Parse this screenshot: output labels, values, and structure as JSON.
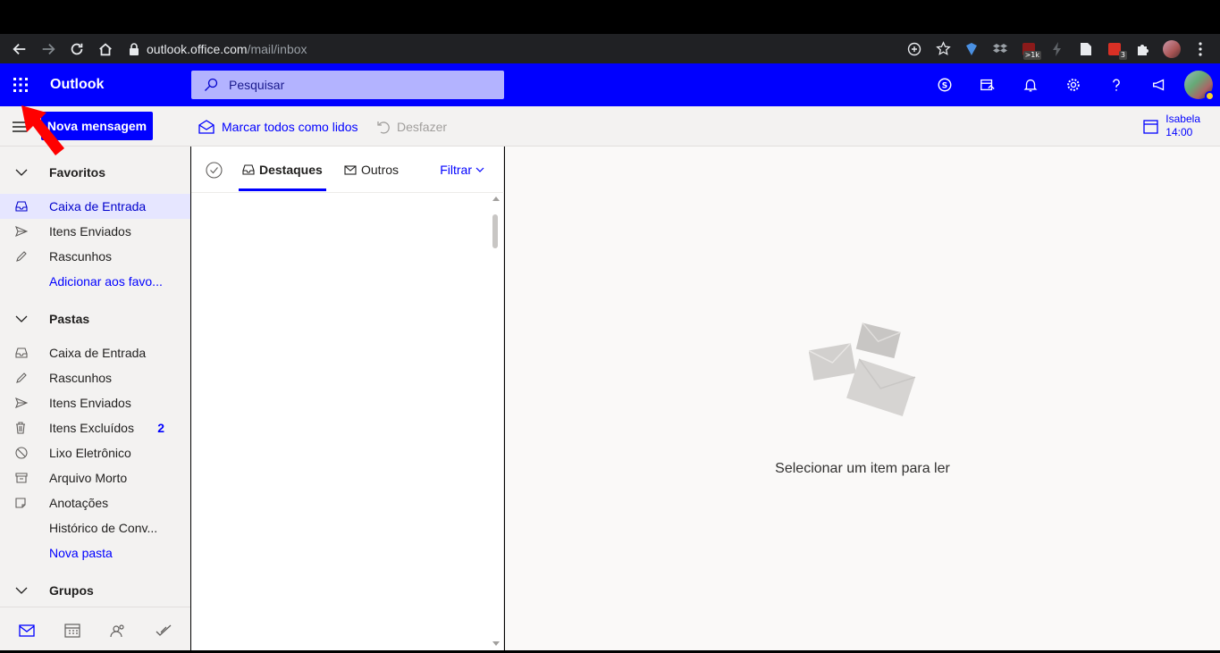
{
  "browser": {
    "url_host": "outlook.office.com",
    "url_path": "/mail/inbox",
    "extensions": [
      {
        "name": "bitwarden-icon"
      },
      {
        "name": "dropbox-icon"
      },
      {
        "name": "pdf-extension-icon",
        "badge": ">1k"
      },
      {
        "name": "flash-icon"
      },
      {
        "name": "document-icon"
      },
      {
        "name": "calendar-extension-icon",
        "badge": "3"
      },
      {
        "name": "puzzle-icon"
      }
    ]
  },
  "header": {
    "app_name": "Outlook",
    "search_placeholder": "Pesquisar"
  },
  "commandbar": {
    "new_message": "Nova mensagem",
    "mark_all_read": "Marcar todos como lidos",
    "undo": "Desfazer",
    "calendar_name": "Isabela",
    "calendar_time": "14:00"
  },
  "nav": {
    "favorites_label": "Favoritos",
    "favorites": [
      {
        "label": "Caixa de Entrada",
        "icon": "inbox-icon",
        "selected": true
      },
      {
        "label": "Itens Enviados",
        "icon": "send-icon"
      },
      {
        "label": "Rascunhos",
        "icon": "pencil-icon"
      }
    ],
    "add_favorite": "Adicionar aos favo...",
    "folders_label": "Pastas",
    "folders": [
      {
        "label": "Caixa de Entrada",
        "icon": "inbox-icon"
      },
      {
        "label": "Rascunhos",
        "icon": "pencil-icon"
      },
      {
        "label": "Itens Enviados",
        "icon": "send-icon"
      },
      {
        "label": "Itens Excluídos",
        "icon": "trash-icon",
        "count": "2"
      },
      {
        "label": "Lixo Eletrônico",
        "icon": "block-icon"
      },
      {
        "label": "Arquivo Morto",
        "icon": "archive-icon"
      },
      {
        "label": "Anotações",
        "icon": "note-icon"
      },
      {
        "label": "Histórico de Conv...",
        "icon": ""
      }
    ],
    "new_folder": "Nova pasta",
    "groups_label": "Grupos"
  },
  "list": {
    "tab_focused": "Destaques",
    "tab_other": "Outros",
    "filter": "Filtrar"
  },
  "reading": {
    "empty_text": "Selecionar um item para ler"
  },
  "colors": {
    "accent": "#0000ff",
    "search_bg": "#b3b3ff",
    "selected_bg": "#e6e6ff",
    "annotation_arrow": "#ff0000"
  }
}
